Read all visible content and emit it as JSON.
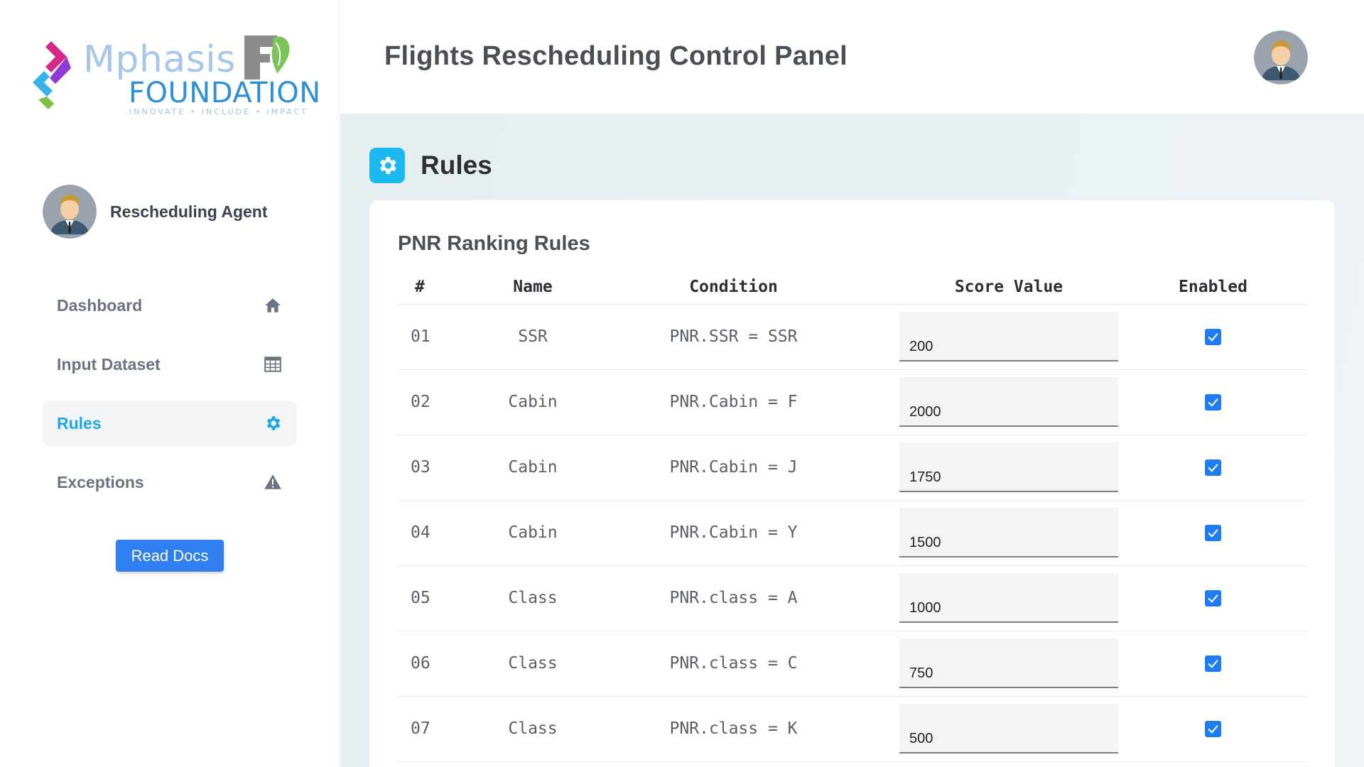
{
  "sidebar": {
    "logo": {
      "brand": "Mphasis",
      "foundation": "FOUNDATION",
      "tagline": "INNOVATE • INCLUDE • IMPACT"
    },
    "profile_name": "Rescheduling Agent",
    "nav": [
      {
        "label": "Dashboard",
        "icon": "home-icon"
      },
      {
        "label": "Input Dataset",
        "icon": "table-icon"
      },
      {
        "label": "Rules",
        "icon": "gear-icon",
        "active": true
      },
      {
        "label": "Exceptions",
        "icon": "warning-icon"
      }
    ],
    "read_docs_label": "Read Docs"
  },
  "header": {
    "title": "Flights Rescheduling Control Panel"
  },
  "section": {
    "title": "Rules",
    "icon": "gear-icon"
  },
  "card": {
    "title": "PNR Ranking Rules",
    "columns": [
      "#",
      "Name",
      "Condition",
      "Score Value",
      "Enabled"
    ],
    "rows": [
      {
        "num": "01",
        "name": "SSR",
        "condition": "PNR.SSR = SSR",
        "score": "200",
        "enabled": true
      },
      {
        "num": "02",
        "name": "Cabin",
        "condition": "PNR.Cabin = F",
        "score": "2000",
        "enabled": true
      },
      {
        "num": "03",
        "name": "Cabin",
        "condition": "PNR.Cabin = J",
        "score": "1750",
        "enabled": true
      },
      {
        "num": "04",
        "name": "Cabin",
        "condition": "PNR.Cabin = Y",
        "score": "1500",
        "enabled": true
      },
      {
        "num": "05",
        "name": "Class",
        "condition": "PNR.class = A",
        "score": "1000",
        "enabled": true
      },
      {
        "num": "06",
        "name": "Class",
        "condition": "PNR.class = C",
        "score": "750",
        "enabled": true
      },
      {
        "num": "07",
        "name": "Class",
        "condition": "PNR.class = K",
        "score": "500",
        "enabled": true
      }
    ]
  },
  "colors": {
    "accent": "#1da8e4",
    "button": "#2f7ff0",
    "checkbox": "#1e7df2"
  }
}
